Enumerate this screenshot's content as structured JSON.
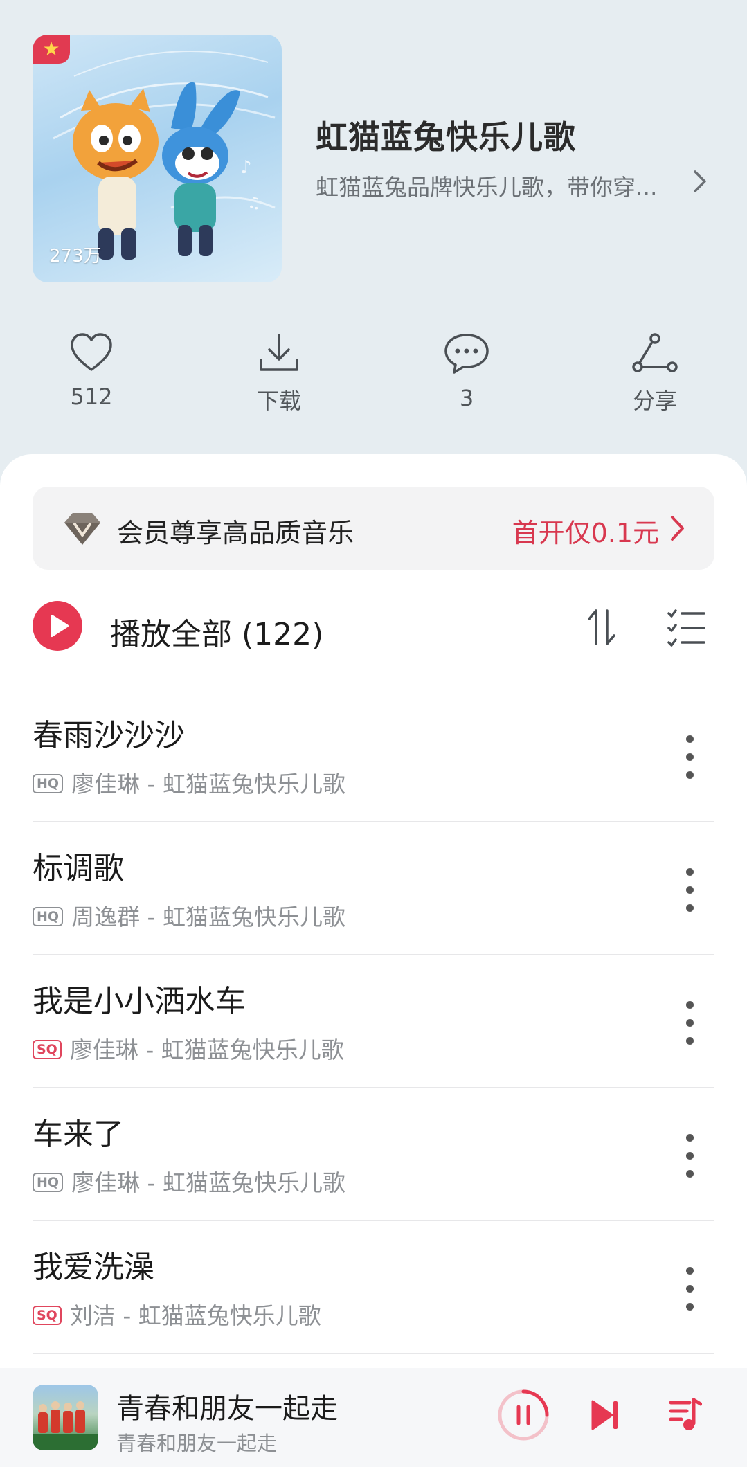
{
  "header": {
    "cover_badge_icon": "star-icon",
    "cover_play_count": "273万",
    "title": "虹猫蓝兔快乐儿歌",
    "description": "虹猫蓝兔品牌快乐儿歌，带你穿...",
    "actions": [
      {
        "icon": "heart-icon",
        "label": "512"
      },
      {
        "icon": "download-icon",
        "label": "下载"
      },
      {
        "icon": "comment-icon",
        "label": "3"
      },
      {
        "icon": "share-icon",
        "label": "分享"
      }
    ]
  },
  "vip": {
    "text": "会员尊享高品质音乐",
    "offer": "首开仅0.1元"
  },
  "playlist": {
    "play_all_label": "播放全部 (122)"
  },
  "songs": [
    {
      "title": "春雨沙沙沙",
      "quality": "HQ",
      "meta": "廖佳琳 - 虹猫蓝兔快乐儿歌"
    },
    {
      "title": "标调歌",
      "quality": "HQ",
      "meta": "周逸群 - 虹猫蓝兔快乐儿歌"
    },
    {
      "title": "我是小小洒水车",
      "quality": "SQ",
      "meta": "廖佳琳 - 虹猫蓝兔快乐儿歌"
    },
    {
      "title": "车来了",
      "quality": "HQ",
      "meta": "廖佳琳 - 虹猫蓝兔快乐儿歌"
    },
    {
      "title": "我爱洗澡",
      "quality": "SQ",
      "meta": "刘洁 - 虹猫蓝兔快乐儿歌"
    }
  ],
  "now_playing": {
    "title": "青春和朋友一起走",
    "subtitle": "青春和朋友一起走"
  },
  "colors": {
    "accent": "#e63852",
    "header_bg": "#e6edf1",
    "sheet_bg": "#ffffff"
  }
}
